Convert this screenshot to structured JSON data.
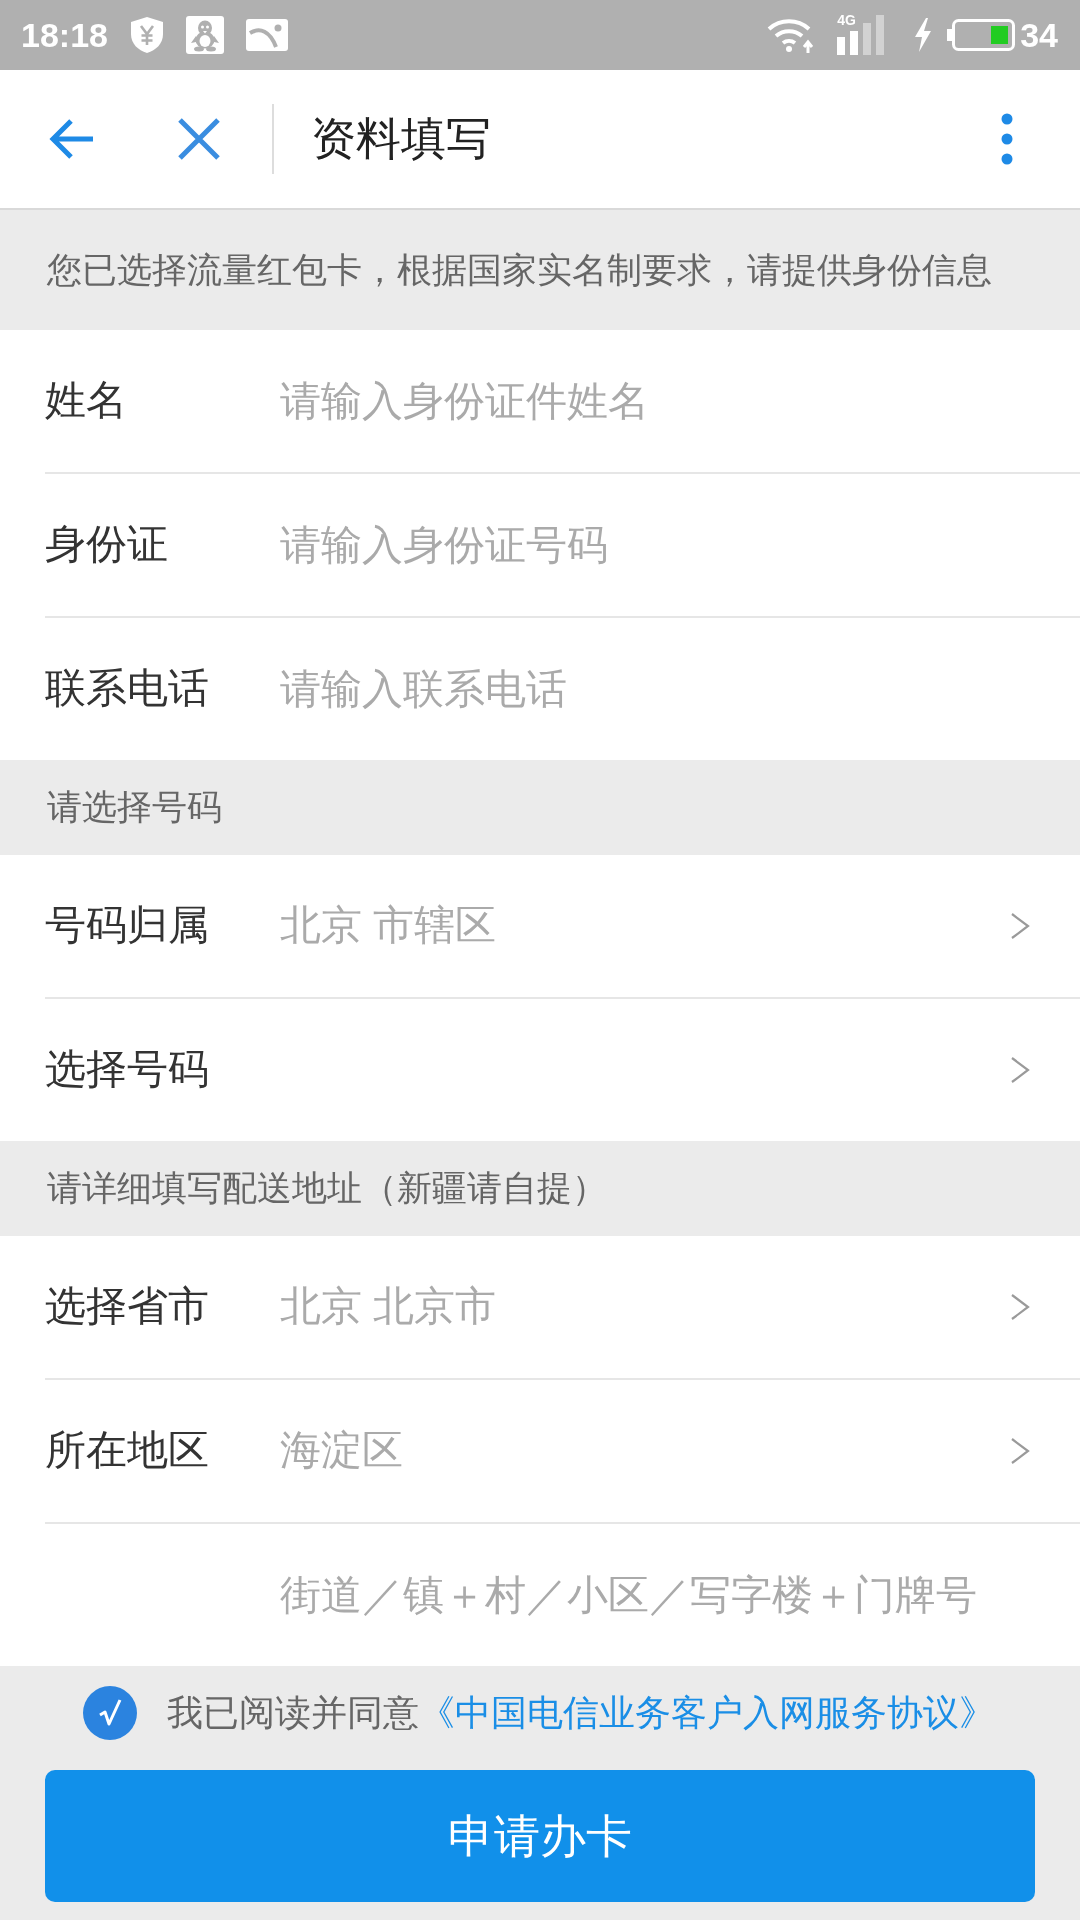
{
  "status_bar": {
    "time": "18:18",
    "network_type": "4G",
    "battery_percent": "34"
  },
  "header": {
    "title": "资料填写"
  },
  "sections": [
    {
      "heading": "您已选择流量红包卡，根据国家实名制要求，请提供身份信息",
      "rows": [
        {
          "kind": "input",
          "label": "姓名",
          "placeholder": "请输入身份证件姓名"
        },
        {
          "kind": "input",
          "label": "身份证",
          "placeholder": "请输入身份证号码"
        },
        {
          "kind": "input",
          "label": "联系电话",
          "placeholder": "请输入联系电话"
        }
      ]
    },
    {
      "heading": "请选择号码",
      "rows": [
        {
          "kind": "picker",
          "label": "号码归属",
          "value": "北京 市辖区"
        },
        {
          "kind": "picker",
          "label": "选择号码"
        }
      ]
    },
    {
      "heading": "请详细填写配送地址（新疆请自提）",
      "rows": [
        {
          "kind": "picker",
          "label": "选择省市",
          "value": "北京 北京市"
        },
        {
          "kind": "picker",
          "label": "所在地区",
          "value": "海淀区"
        },
        {
          "kind": "input",
          "placeholder": "街道／镇＋村／小区／写字楼＋门牌号"
        }
      ]
    }
  ],
  "agreement": {
    "checked": true,
    "text": "我已阅读并同意",
    "link": "《中国电信业务客户入网服务协议》"
  },
  "submit_button": {
    "label": "申请办卡"
  }
}
